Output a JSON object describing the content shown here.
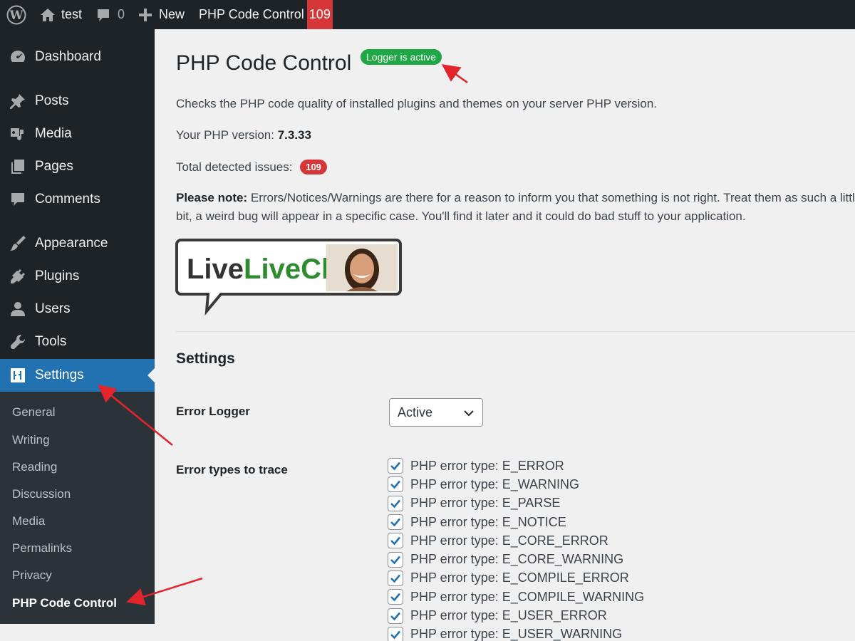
{
  "adminbar": {
    "site_name": "test",
    "comments_count": "0",
    "new_label": "New",
    "plugin_label": "PHP Code Control",
    "plugin_badge": "109"
  },
  "sidebar": {
    "items": [
      {
        "label": "Dashboard",
        "icon": "dashboard-icon"
      },
      {
        "label": "Posts",
        "icon": "pin-icon"
      },
      {
        "label": "Media",
        "icon": "media-icon"
      },
      {
        "label": "Pages",
        "icon": "pages-icon"
      },
      {
        "label": "Comments",
        "icon": "comment-icon"
      },
      {
        "label": "Appearance",
        "icon": "brush-icon"
      },
      {
        "label": "Plugins",
        "icon": "plug-icon"
      },
      {
        "label": "Users",
        "icon": "user-icon"
      },
      {
        "label": "Tools",
        "icon": "wrench-icon"
      },
      {
        "label": "Settings",
        "icon": "settings-icon"
      }
    ],
    "submenu": [
      "General",
      "Writing",
      "Reading",
      "Discussion",
      "Media",
      "Permalinks",
      "Privacy",
      "PHP Code Control"
    ]
  },
  "main": {
    "title": "PHP Code Control",
    "status_pill": "Logger is active",
    "description": "Checks the PHP code quality of installed plugins and themes on your server PHP version.",
    "php_version_label": "Your PHP version:",
    "php_version": "7.3.33",
    "issues_label": "Total detected issues:",
    "issues_count": "109",
    "note_label": "Please note:",
    "note_text": "Errors/Notices/Warnings are there for a reason to inform you that something is not right. Treat them as such a little bit, a weird bug will appear in a specific case. You'll find it later and it could do bad stuff to your application.",
    "banner_text": "LiveChat",
    "settings_title": "Settings",
    "error_logger_label": "Error Logger",
    "error_logger_value": "Active",
    "error_types_label": "Error types to trace",
    "error_types": [
      "PHP error type: E_ERROR",
      "PHP error type: E_WARNING",
      "PHP error type: E_PARSE",
      "PHP error type: E_NOTICE",
      "PHP error type: E_CORE_ERROR",
      "PHP error type: E_CORE_WARNING",
      "PHP error type: E_COMPILE_ERROR",
      "PHP error type: E_COMPILE_WARNING",
      "PHP error type: E_USER_ERROR",
      "PHP error type: E_USER_WARNING"
    ]
  },
  "colors": {
    "adminbar_bg": "#1d2327",
    "menu_current": "#2271b1",
    "submenu_bg": "#2c3338",
    "badge_red": "#d63638",
    "pill_green": "#1ea744",
    "checkbox_blue": "#2271b1",
    "arrow_red": "#e3242b"
  }
}
